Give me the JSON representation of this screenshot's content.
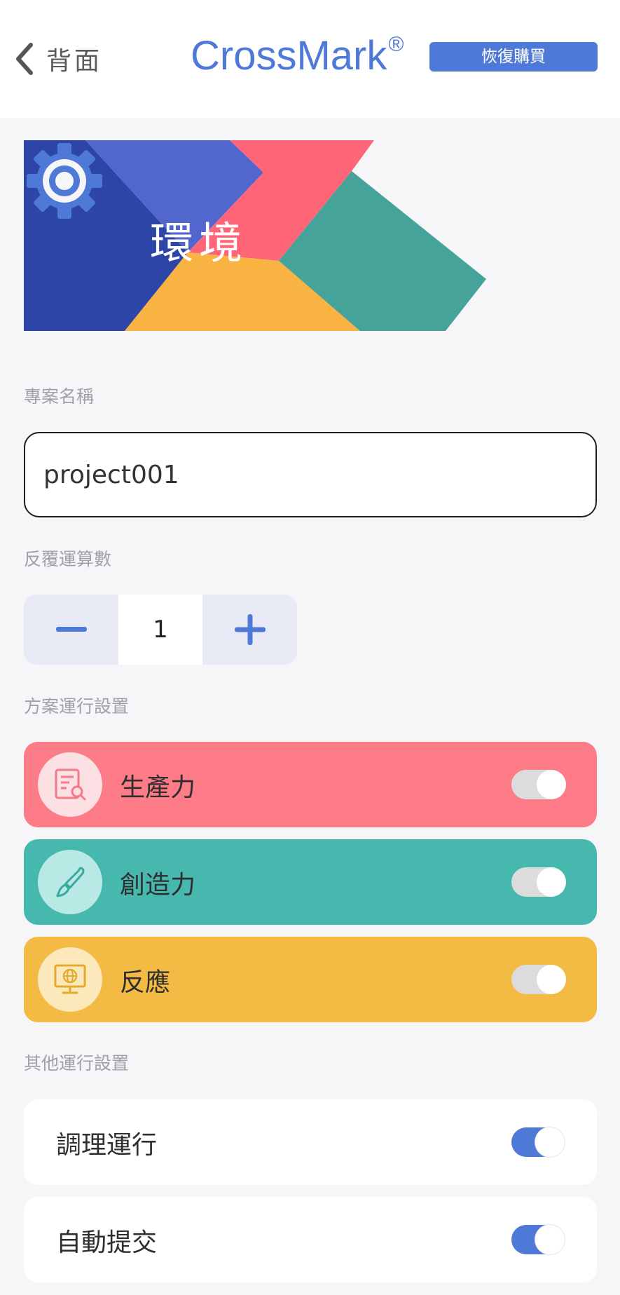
{
  "header": {
    "back_label": "背面",
    "brand": "CrossMark",
    "brand_mark": "®",
    "restore_button": "恢復購買"
  },
  "banner": {
    "title": "環境",
    "settings_icon": "gear-icon",
    "colors": {
      "navy": "#2e45a8",
      "blue": "#5167cd",
      "red": "#fe6577",
      "teal": "#45a39a",
      "orange": "#f8b343"
    }
  },
  "project": {
    "label": "專案名稱",
    "value": "project001"
  },
  "iterations": {
    "label": "反覆運算數",
    "value": "1",
    "minus_icon": "minus-icon",
    "plus_icon": "plus-icon"
  },
  "scenario": {
    "label": "方案運行設置",
    "items": [
      {
        "label": "生產力",
        "icon": "report-search-icon",
        "color": "#fe7b88",
        "icon_bg": "#fde0e4"
      },
      {
        "label": "創造力",
        "icon": "brush-icon",
        "color": "#46b8ae",
        "icon_bg": "#b9e9e4"
      },
      {
        "label": "反應",
        "icon": "monitor-globe-icon",
        "color": "#f3bb44",
        "icon_bg": "#fbe9bb"
      }
    ]
  },
  "other": {
    "label": "其他運行設置",
    "items": [
      {
        "label": "調理運行",
        "enabled": true
      },
      {
        "label": "自動提交",
        "enabled": true
      }
    ]
  },
  "accent_color": "#4f79d6"
}
